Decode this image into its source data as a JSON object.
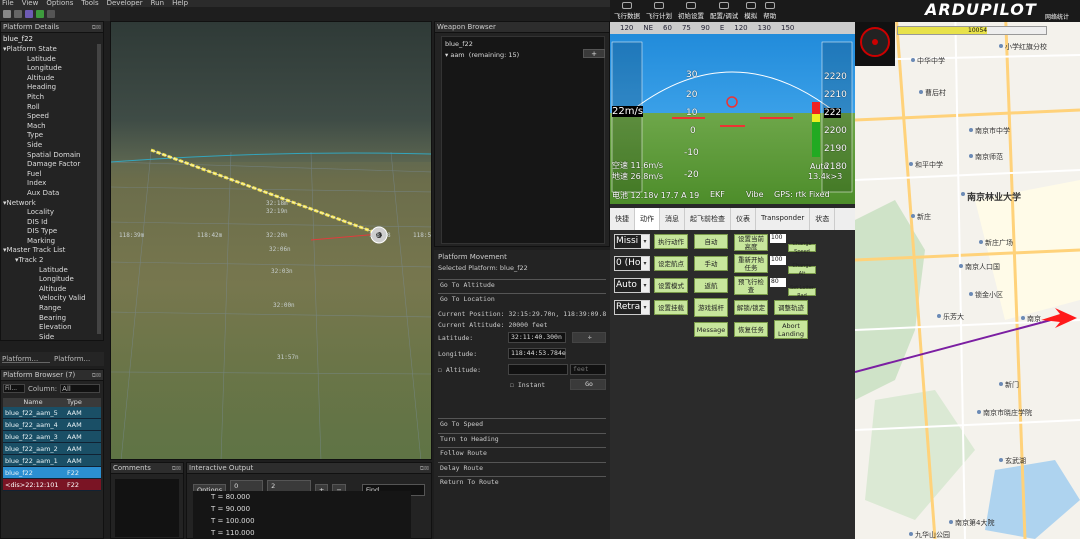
{
  "menubar": [
    "File",
    "View",
    "Options",
    "Tools",
    "Developer",
    "Run",
    "Help"
  ],
  "platform_details": {
    "title": "Platform Details",
    "platform_name": "blue_f22",
    "items": [
      {
        "label": "Platform State",
        "level": 1,
        "toggle": "▾"
      },
      {
        "label": "Latitude",
        "level": 2
      },
      {
        "label": "Longitude",
        "level": 2
      },
      {
        "label": "Altitude",
        "level": 2
      },
      {
        "label": "Heading",
        "level": 2
      },
      {
        "label": "Pitch",
        "level": 2
      },
      {
        "label": "Roll",
        "level": 2
      },
      {
        "label": "Speed",
        "level": 2
      },
      {
        "label": "Mach",
        "level": 2
      },
      {
        "label": "Type",
        "level": 2
      },
      {
        "label": "Side",
        "level": 2
      },
      {
        "label": "Spatial Domain",
        "level": 2
      },
      {
        "label": "Damage Factor",
        "level": 2
      },
      {
        "label": "Fuel",
        "level": 2
      },
      {
        "label": "Index",
        "level": 2
      },
      {
        "label": "Aux Data",
        "level": 2
      },
      {
        "label": "Network",
        "level": 1,
        "toggle": "▾"
      },
      {
        "label": "Locality",
        "level": 2
      },
      {
        "label": "DIS Id",
        "level": 2
      },
      {
        "label": "DIS Type",
        "level": 2
      },
      {
        "label": "Marking",
        "level": 2
      },
      {
        "label": "Master Track List",
        "level": 1,
        "toggle": "▾"
      },
      {
        "label": "Track 2",
        "level": 2,
        "toggle": "▾"
      },
      {
        "label": "Latitude",
        "level": 3
      },
      {
        "label": "Longitude",
        "level": 3
      },
      {
        "label": "Altitude",
        "level": 3
      },
      {
        "label": "Velocity Valid",
        "level": 3
      },
      {
        "label": "Range",
        "level": 3
      },
      {
        "label": "Bearing",
        "level": 3
      },
      {
        "label": "Elevation",
        "level": 3
      },
      {
        "label": "Side",
        "level": 3
      }
    ],
    "tabs": [
      "Platform...",
      "Platform..."
    ]
  },
  "platform_browser": {
    "title": "Platform Browser (7)",
    "filter_label": "Fil...",
    "column_label": "Column:",
    "column_value": "All",
    "headers": [
      "Name",
      "Type"
    ],
    "rows": [
      {
        "name": "blue_f22_aam_5",
        "type": "AAM",
        "style": "normal"
      },
      {
        "name": "blue_f22_aam_4",
        "type": "AAM",
        "style": "normal"
      },
      {
        "name": "blue_f22_aam_3",
        "type": "AAM",
        "style": "normal"
      },
      {
        "name": "blue_f22_aam_2",
        "type": "AAM",
        "style": "normal"
      },
      {
        "name": "blue_f22_aam_1",
        "type": "AAM",
        "style": "normal"
      },
      {
        "name": "blue_f22",
        "type": "F22",
        "style": "selected"
      },
      {
        "name": "<dis>22:12:101",
        "type": "F22",
        "style": "dis"
      }
    ]
  },
  "view3d": {
    "labels": [
      "118:39m",
      "118:42m",
      "32:18m",
      "32:19n",
      "32:20n",
      "32:06n",
      "32:03n",
      "32:00n",
      "31:57n",
      "118:48",
      "118:5"
    ]
  },
  "comments": {
    "title": "Comments"
  },
  "output": {
    "title": "Interactive Output",
    "options_label": "Options",
    "errors_label": "0 Errors",
    "warnings_label": "2 Warnings",
    "plus": "+",
    "minus": "−",
    "find_placeholder": "Find...",
    "lines": [
      "T = 80.000",
      "T = 90.000",
      "T = 100.000",
      "T = 110.000"
    ]
  },
  "weapon_browser": {
    "title": "Weapon Browser",
    "platform": "blue_f22",
    "weapon": "aam",
    "remaining": "(remaining: 15)",
    "add_label": "+"
  },
  "platform_movement": {
    "title": "Platform Movement",
    "selected": "Selected Platform: blue_f22",
    "go_to_altitude": "Go To Altitude",
    "go_to_location": "Go To Location",
    "current_position": "Current Position: 32:15:29.70n, 118:39:09.8",
    "current_altitude": "Current Altitude: 20000 feet",
    "latitude_label": "Latitude:",
    "latitude_value": "32:11:40.300n",
    "longitude_label": "Longitude:",
    "longitude_value": "118:44:53.784e",
    "altitude_label": "Altitude:",
    "altitude_unit": "feet",
    "instant_label": "Instant",
    "go_label": "Go",
    "sections": [
      "Go To Speed",
      "Turn to Heading",
      "Follow Route",
      "Delay Route",
      "Return To Route"
    ]
  },
  "mission_planner": {
    "top_buttons": [
      "飞行数据",
      "飞行计划",
      "初始设置",
      "配置/调试",
      "模拟",
      "帮助"
    ],
    "compass": [
      "120",
      "NE",
      "60",
      "75",
      "90",
      "E",
      "120",
      "130",
      "150"
    ],
    "hud": {
      "speed_left": "22m/s",
      "pitch_marks": [
        "30",
        "20",
        "10",
        "0",
        "-10",
        "-20"
      ],
      "alt_right": [
        "2220",
        "2210",
        "222",
        "2200",
        "2190",
        "2180"
      ],
      "airspeed": "空速 11.6m/s",
      "groundspeed": "地速 26.8m/s",
      "battery": "电池 12.18v 17.7 A 19",
      "ekf": "EKF",
      "vibe": "Vibe",
      "gps": "GPS: rtk Fixed",
      "mode": "Auto",
      "wp": "13.4k>3"
    },
    "tabs": [
      "快捷",
      "动作",
      "消息",
      "起飞前检查",
      "仪表",
      "Transponder",
      "状态"
    ],
    "active_tab": 1,
    "dropdowns": [
      "Missi",
      "0 (Ho",
      "Auto",
      "Retra"
    ],
    "buttons": {
      "exec_action": "执行动作",
      "auto": "自动",
      "set_mount": "设置当前高度",
      "set_wp": "设定航点",
      "manual": "手动",
      "restart_mission": "重新开始任务",
      "set_mode": "设置模式",
      "rtl": "返航",
      "arm_disarm": "解锁/锁定",
      "preflight_cal": "预飞行检查",
      "joystick": "游戏摇杆",
      "set_home": "设置挂载",
      "resume_mission": "恢复任务",
      "message": "Message",
      "abort_landing": "Abort Landing",
      "change_speed": "Change Speed",
      "change_alt": "Change Alt",
      "set_loiter": "Set Loiter Rad",
      "adjust_route": "调整轨迹"
    },
    "num_values": [
      "100",
      "100",
      "80"
    ]
  },
  "map": {
    "brand": "ARDUPILOT",
    "link": "网络统计",
    "bar_value": "10054",
    "places": [
      "小学红旗分校",
      "中华中学",
      "曹后村",
      "南京市中学",
      "和平中学",
      "南京师范",
      "南京林业大学",
      "新庄",
      "新庄广场",
      "南京人口国",
      "乐芳大",
      "南京",
      "锁金小区",
      "南京市晓庄学院",
      "玄武湖",
      "九华山公园",
      "南京第4大院",
      "新门"
    ]
  },
  "colors": {
    "accent": "#2b8fd1",
    "dis_row": "#7a1424",
    "hud_sky": "#3aa0e8",
    "hud_ground": "#6ea74a",
    "mp_button": "#c7e69c",
    "route": "#7b1fa2",
    "aircraft": "#ff1a1a"
  }
}
